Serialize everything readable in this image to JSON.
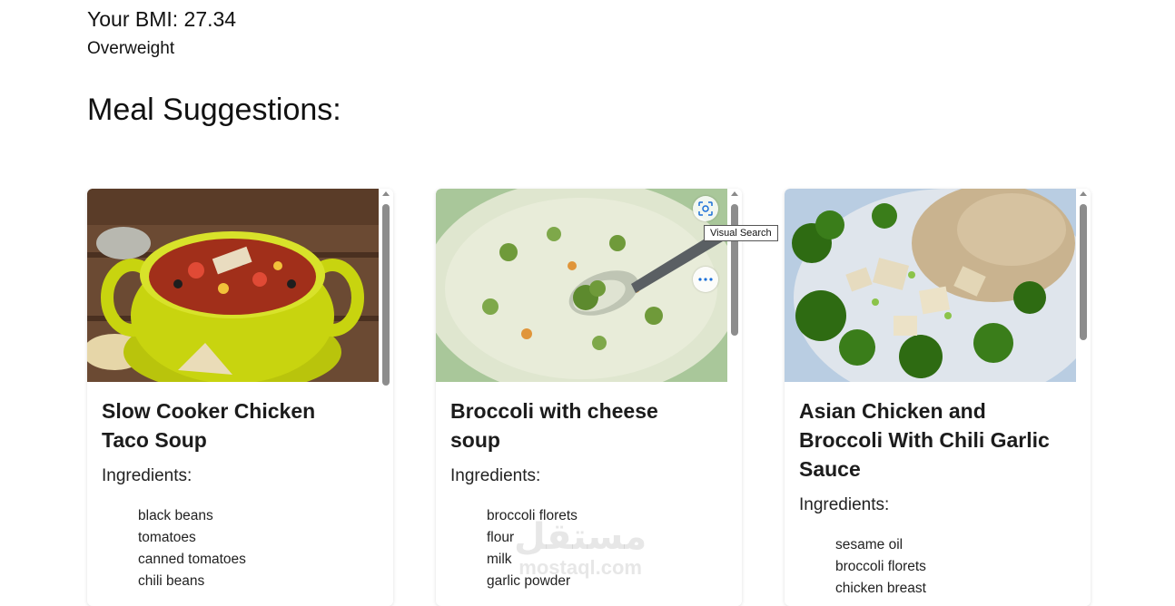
{
  "bmi": {
    "value_text": "Your BMI: 27.34",
    "category": "Overweight"
  },
  "section_title": "Meal Suggestions:",
  "ingredients_label": "Ingredients:",
  "meals": [
    {
      "title": "Slow Cooker Chicken Taco Soup",
      "ingredients": [
        "black beans",
        "tomatoes",
        "canned tomatoes",
        "chili beans"
      ]
    },
    {
      "title": "Broccoli with cheese soup",
      "ingredients": [
        "broccoli florets",
        "flour",
        "milk",
        "garlic powder"
      ]
    },
    {
      "title": "Asian Chicken and Broccoli With Chili Garlic Sauce",
      "ingredients": [
        "sesame oil",
        "broccoli florets",
        "chicken breast"
      ]
    }
  ],
  "image_overlay": {
    "tooltip": "Visual Search",
    "icons": [
      "visual-search-icon",
      "more-options-icon"
    ]
  },
  "watermark": {
    "arabic": "مستقل",
    "latin": "mostaql.com"
  },
  "colors": {
    "soup_bowl": "#c8d40f",
    "broccoli": "#2e6b12",
    "soup_cream": "#e4e8cf",
    "rice": "#c9b38f"
  }
}
